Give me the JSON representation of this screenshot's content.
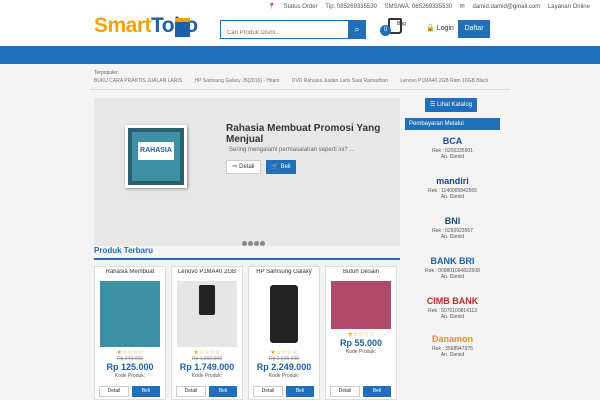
{
  "header": {
    "logo_part1": "Smart",
    "logo_part2": "Toko",
    "links": [
      "Status Order",
      "Tlp: 085269335530",
      "SMS/WA: 085269335530",
      "damid.damid@gmail.com",
      "Layanan Online"
    ],
    "search_placeholder": "Cari Produk Disini...",
    "search_icon": "search-icon",
    "cart_count": "0",
    "cart_label": "Bag",
    "login_label": "Login",
    "daftar_label": "Daftar"
  },
  "popular": {
    "title": "Terpopuler:",
    "items": [
      "BUKU CARA PRAKTIS JUALAN LARIS",
      "HP Samsung Galaxy J5(2016) - Hitam",
      "DVD Rahasia Jualan Laris Saat Ramadhan",
      "Lenovo P1MA40 2GB Ram 16GB Black"
    ]
  },
  "slider": {
    "book_text": "RAHASIA",
    "title": "Rahasia Membuat Promosi Yang Menjual",
    "desc": "Sering mengalami permasalahan seperti ini? ...",
    "detail_label": "Detail",
    "beli_label": "Beli"
  },
  "sidebar": {
    "katalog_label": "Lihat Katalog",
    "payment_title": "Pembayaran Melalui",
    "banks": [
      {
        "name": "BCA",
        "rek": "Rek : 0200335901",
        "an": "An. Damid",
        "color": "#1f4fa0"
      },
      {
        "name": "mandiri",
        "rek": "Rek : 1140005842565",
        "an": "An. Damid",
        "color": "#1f3f80"
      },
      {
        "name": "BNI",
        "rek": "Rek : 0250923567",
        "an": "An. Damid",
        "color": "#1f4f70"
      },
      {
        "name": "BANK BRI",
        "rek": "Rek : 009801094822508",
        "an": "An. Damid",
        "color": "#1f5fa8"
      },
      {
        "name": "CIMB BANK",
        "rek": "Rek : 5070100814113",
        "an": "An. Damid",
        "color": "#c0282d"
      },
      {
        "name": "Danamon",
        "rek": "Rek : 3568947075",
        "an": "An. Damid",
        "color": "#f08a1a"
      }
    ]
  },
  "produk": {
    "title": "Produk Terbaru",
    "items": [
      {
        "name": "Rahasia Membuat",
        "old": "Rp 249.000",
        "price": "Rp 125.000",
        "kode": "Kode Produk:",
        "stars": "★☆☆☆☆",
        "detail": "Detail",
        "beli": "Beli"
      },
      {
        "name": "Lenovo P1MA40 2GB",
        "old": "Rp 1.890.000",
        "price": "Rp 1.749.000",
        "kode": "Kode Produk:",
        "stars": "★☆☆☆☆",
        "detail": "Detail",
        "beli": "Beli"
      },
      {
        "name": "HP Samsung Galaxy",
        "old": "Rp 2.599.000",
        "price": "Rp 2.249.000",
        "kode": "Kode Produk:",
        "stars": "★☆☆☆☆",
        "detail": "Detail",
        "beli": "Beli"
      },
      {
        "name": "Butuh Desain",
        "old": "",
        "price": "Rp 55.000",
        "kode": "Kode Produk:",
        "stars": "★☆☆☆☆",
        "detail": "Detail",
        "beli": "Beli"
      }
    ]
  },
  "colors": {
    "accent": "#1f6fba",
    "logo_orange": "#f0a30a"
  }
}
